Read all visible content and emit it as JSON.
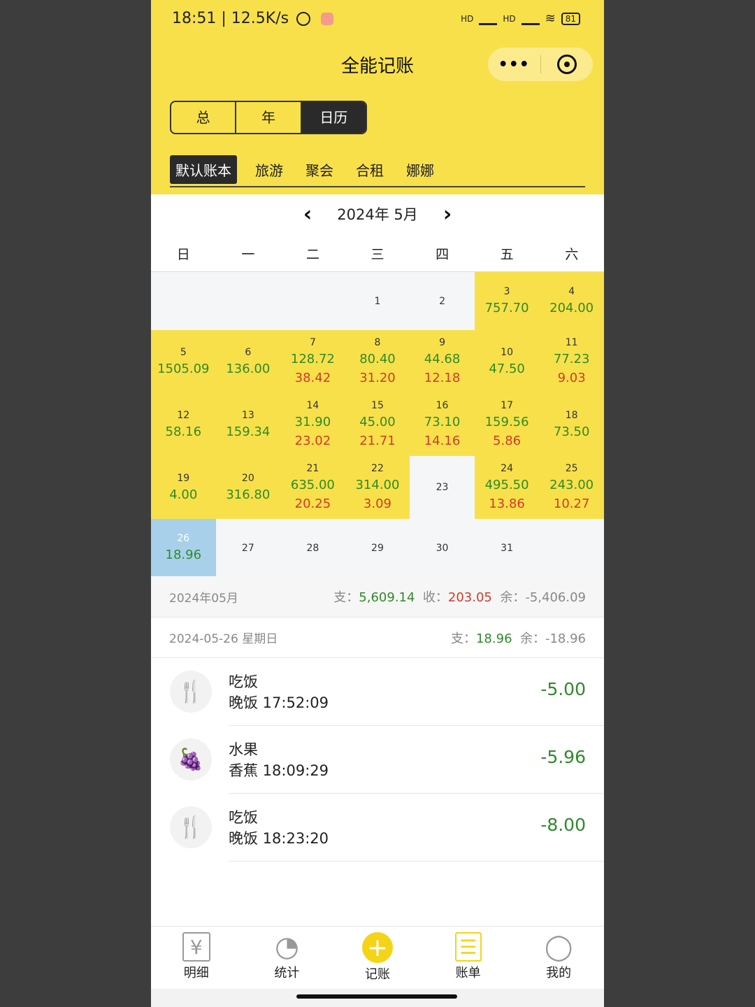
{
  "status": {
    "time": "18:51 | 12.5K/s",
    "battery": "81",
    "signal1": "HD",
    "signal2": "HD"
  },
  "header": {
    "title": "全能记账",
    "more_label": "•••"
  },
  "segments": [
    "总",
    "年",
    "日历"
  ],
  "books": [
    "默认账本",
    "旅游",
    "聚会",
    "合租",
    "娜娜"
  ],
  "month_nav": {
    "label": "2024年 5月",
    "prev": "‹",
    "next": "›"
  },
  "weekdays": [
    "日",
    "一",
    "二",
    "三",
    "四",
    "五",
    "六"
  ],
  "calendar": {
    "weeks": [
      [
        {
          "day": "",
          "expense": "",
          "income": "",
          "type": "empty"
        },
        {
          "day": "",
          "expense": "",
          "income": "",
          "type": "empty"
        },
        {
          "day": "",
          "expense": "",
          "income": "",
          "type": "empty"
        },
        {
          "day": "1",
          "expense": "",
          "income": "",
          "type": "empty"
        },
        {
          "day": "2",
          "expense": "",
          "income": "",
          "type": "empty"
        },
        {
          "day": "3",
          "expense": "757.70",
          "income": "",
          "type": "filled"
        },
        {
          "day": "4",
          "expense": "204.00",
          "income": "",
          "type": "filled"
        }
      ],
      [
        {
          "day": "5",
          "expense": "1505.09",
          "income": "",
          "type": "filled"
        },
        {
          "day": "6",
          "expense": "136.00",
          "income": "",
          "type": "filled"
        },
        {
          "day": "7",
          "expense": "128.72",
          "income": "38.42",
          "type": "filled"
        },
        {
          "day": "8",
          "expense": "80.40",
          "income": "31.20",
          "type": "filled"
        },
        {
          "day": "9",
          "expense": "44.68",
          "income": "12.18",
          "type": "filled"
        },
        {
          "day": "10",
          "expense": "47.50",
          "income": "",
          "type": "filled"
        },
        {
          "day": "11",
          "expense": "77.23",
          "income": "9.03",
          "type": "filled"
        }
      ],
      [
        {
          "day": "12",
          "expense": "58.16",
          "income": "",
          "type": "filled"
        },
        {
          "day": "13",
          "expense": "159.34",
          "income": "",
          "type": "filled"
        },
        {
          "day": "14",
          "expense": "31.90",
          "income": "23.02",
          "type": "filled"
        },
        {
          "day": "15",
          "expense": "45.00",
          "income": "21.71",
          "type": "filled"
        },
        {
          "day": "16",
          "expense": "73.10",
          "income": "14.16",
          "type": "filled"
        },
        {
          "day": "17",
          "expense": "159.56",
          "income": "5.86",
          "type": "filled"
        },
        {
          "day": "18",
          "expense": "73.50",
          "income": "",
          "type": "filled"
        }
      ],
      [
        {
          "day": "19",
          "expense": "4.00",
          "income": "",
          "type": "filled"
        },
        {
          "day": "20",
          "expense": "316.80",
          "income": "",
          "type": "filled"
        },
        {
          "day": "21",
          "expense": "635.00",
          "income": "20.25",
          "type": "filled"
        },
        {
          "day": "22",
          "expense": "314.00",
          "income": "3.09",
          "type": "filled"
        },
        {
          "day": "23",
          "expense": "",
          "income": "",
          "type": "empty"
        },
        {
          "day": "24",
          "expense": "495.50",
          "income": "13.86",
          "type": "filled"
        },
        {
          "day": "25",
          "expense": "243.00",
          "income": "10.27",
          "type": "filled"
        }
      ],
      [
        {
          "day": "26",
          "expense": "18.96",
          "income": "",
          "type": "today"
        },
        {
          "day": "27",
          "expense": "",
          "income": "",
          "type": "empty"
        },
        {
          "day": "28",
          "expense": "",
          "income": "",
          "type": "empty"
        },
        {
          "day": "29",
          "expense": "",
          "income": "",
          "type": "empty"
        },
        {
          "day": "30",
          "expense": "",
          "income": "",
          "type": "empty"
        },
        {
          "day": "31",
          "expense": "",
          "income": "",
          "type": "empty"
        },
        {
          "day": "",
          "expense": "",
          "income": "",
          "type": "empty"
        }
      ]
    ]
  },
  "month_summary": {
    "label": "2024年05月",
    "expense_label": "支：",
    "expense": "5,609.14",
    "income_label": "收：",
    "income": "203.05",
    "balance_label": "余：",
    "balance": "-5,406.09"
  },
  "day_summary": {
    "label": "2024-05-26 星期日",
    "expense_label": "支：",
    "expense": "18.96",
    "balance_label": "余：",
    "balance": "-18.96"
  },
  "transactions": [
    {
      "category": "吃饭",
      "note": "晚饭 17:52:09",
      "amount": "-5.00",
      "icon": "utensils-icon",
      "glyph": "🍴"
    },
    {
      "category": "水果",
      "note": "香蕉 18:09:29",
      "amount": "-5.96",
      "icon": "fruit-icon",
      "glyph": "🍇"
    },
    {
      "category": "吃饭",
      "note": "晚饭 18:23:20",
      "amount": "-8.00",
      "icon": "utensils-icon",
      "glyph": "🍴"
    }
  ],
  "tabbar": [
    {
      "label": "明细",
      "icon": "details-icon",
      "glyph": "¥"
    },
    {
      "label": "统计",
      "icon": "pie-chart-icon",
      "glyph": "◔"
    },
    {
      "label": "记账",
      "icon": "add-icon",
      "glyph": "+"
    },
    {
      "label": "账单",
      "icon": "bill-icon",
      "glyph": "☰"
    },
    {
      "label": "我的",
      "icon": "user-icon",
      "glyph": "◯"
    }
  ],
  "colors": {
    "accent": "#f8e04a",
    "expense": "#2f8a2a",
    "income": "#d23a2a",
    "today": "#a8d0ea"
  }
}
